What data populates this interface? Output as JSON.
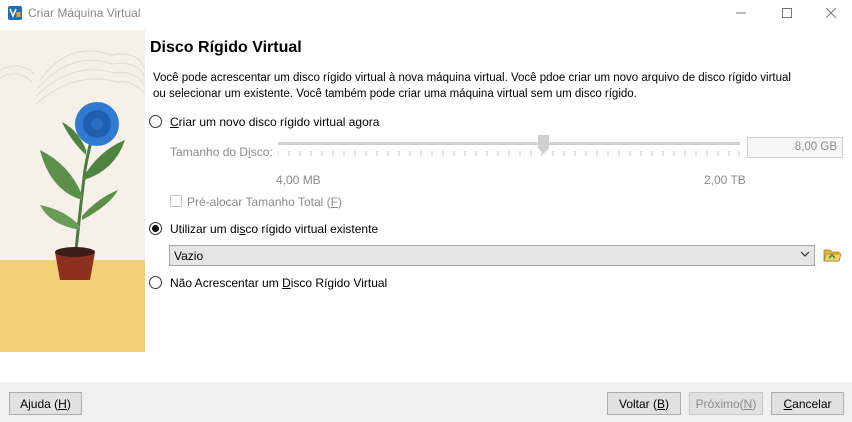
{
  "window": {
    "title": "Criar Máquina Virtual"
  },
  "page": {
    "heading": "Disco Rígido Virtual",
    "description": "Você pode acrescentar um disco rígido virtual à nova máquina virtual. Você pdoe criar um novo arquivo de disco rígido virtual ou selecionar um existente. Você também pode criar uma máquina virtual sem um disco rígido."
  },
  "options": {
    "create_new": {
      "prefix": "C",
      "rest": "riar um novo disco rígido virtual agora",
      "selected": false
    },
    "use_existing": {
      "prefix": "Utilizar um di",
      "underline": "s",
      "rest": "co rígido virtual existente",
      "selected": true
    },
    "no_disk": {
      "prefix": "Não Acrescentar um ",
      "underline": "D",
      "rest": "isco Rígido Virtual",
      "selected": false
    }
  },
  "disk_size": {
    "label_prefix": "Tamanho do D",
    "label_underline": "i",
    "label_rest": "sco:",
    "value": "8,00 GB",
    "min_label": "4,00 MB",
    "max_label": "2,00 TB",
    "slider_fraction": 0.57
  },
  "preallocate": {
    "label_prefix": "Pré-alocar Tamanho Total (",
    "label_underline": "F",
    "label_rest": ")",
    "checked": false
  },
  "existing_disk": {
    "selected": "Vazio"
  },
  "buttons": {
    "help": {
      "prefix": "Ajuda (",
      "underline": "H",
      "rest": ")"
    },
    "back": {
      "prefix": "Voltar (",
      "underline": "B",
      "rest": ")"
    },
    "next": {
      "prefix": "Próximo(",
      "underline": "N",
      "rest": ")"
    },
    "cancel": {
      "prefix": "",
      "underline": "C",
      "rest": "ancelar"
    }
  },
  "icons": {
    "app": "virtualbox-icon",
    "minimize": "minimize-icon",
    "maximize": "maximize-icon",
    "close": "close-icon",
    "folder": "folder-open-icon",
    "dropdown": "chevron-down-icon"
  }
}
